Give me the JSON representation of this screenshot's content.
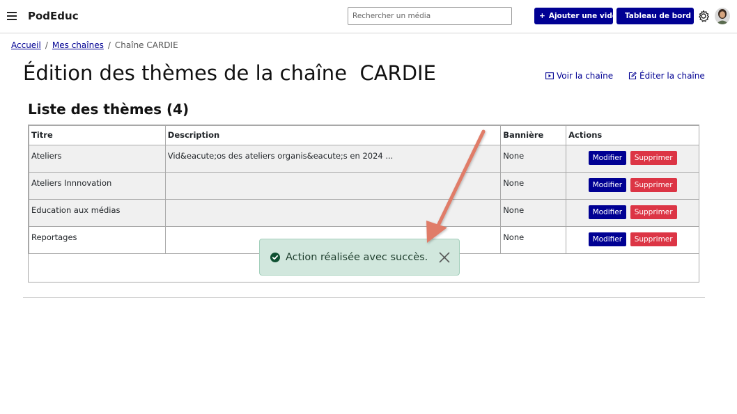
{
  "navbar": {
    "brand": "PodEduc",
    "search_placeholder": "Rechercher un média",
    "add_video_label": "Ajouter une vidéo",
    "dashboard_label": "Tableau de bord"
  },
  "breadcrumb": {
    "home": "Accueil",
    "separator": "/",
    "channels": "Mes chaînes",
    "current": "Chaîne CARDIE"
  },
  "page": {
    "title": "Édition des thèmes de la chaîne  CARDIE",
    "see_channel": "Voir la chaîne",
    "edit_channel": "Éditer la chaîne",
    "subtitle": "Liste des thèmes (4)"
  },
  "table": {
    "headers": [
      "Titre",
      "Description",
      "Bannière",
      "Actions"
    ],
    "rows": [
      {
        "title": "Ateliers",
        "description": "Vid&eacute;os des ateliers organis&eacute;s en 2024 ...",
        "banner": "None"
      },
      {
        "title": "Ateliers Innnovation",
        "description": "",
        "banner": "None"
      },
      {
        "title": "Education aux médias",
        "description": "",
        "banner": "None"
      },
      {
        "title": "Reportages",
        "description": "",
        "banner": "None"
      }
    ],
    "edit_label": "Modifier",
    "delete_label": "Supprimer"
  },
  "toast": {
    "message": "Action réalisée avec succès."
  },
  "colors": {
    "primary": "#000093",
    "danger": "#dc3545",
    "success_bg": "#d1e7dd",
    "annotation_arrow": "#e07b67"
  },
  "icons": [
    "menu-icon",
    "plus-icon",
    "film-icon",
    "gear-icon",
    "play-icon",
    "edit-icon",
    "check-circle-icon",
    "close-icon"
  ]
}
